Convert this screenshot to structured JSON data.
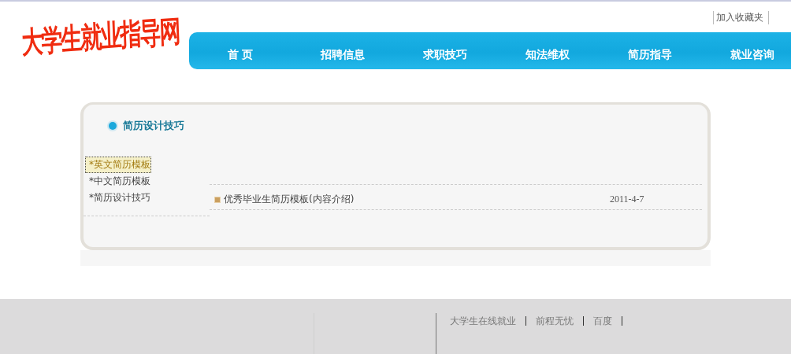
{
  "header": {
    "logo": "大学生就业指导网",
    "favorite_link": "加入收藏夹"
  },
  "nav": [
    {
      "label": "首 页"
    },
    {
      "label": "招聘信息"
    },
    {
      "label": "求职技巧"
    },
    {
      "label": "知法维权"
    },
    {
      "label": "简历指导"
    },
    {
      "label": "就业咨询"
    }
  ],
  "panel": {
    "title": "简历设计技巧",
    "categories": [
      {
        "label": "*英文简历模板",
        "selected": true
      },
      {
        "label": "*中文简历模板",
        "selected": false
      },
      {
        "label": "*简历设计技巧",
        "selected": false
      }
    ],
    "articles": [
      {
        "title": "优秀毕业生简历模板(内容介绍)",
        "date": "2011-4-7"
      }
    ]
  },
  "footer": {
    "links": [
      "大学生在线就业",
      "前程无忧",
      "百度"
    ]
  }
}
